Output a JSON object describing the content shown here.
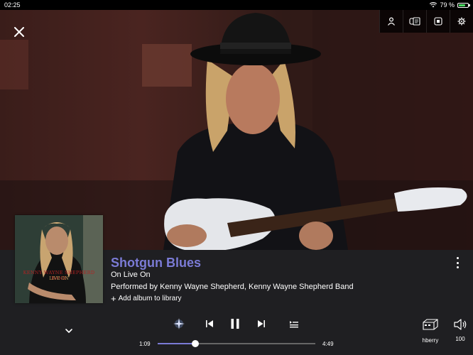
{
  "status_bar": {
    "time": "02:25",
    "battery_text": "79 %",
    "battery_level": 0.79
  },
  "header": {
    "close_icon": "close-icon",
    "icons": [
      "person-icon",
      "lyrics-icon",
      "stop-square-icon",
      "gear-icon"
    ]
  },
  "track": {
    "title": "Shotgun Blues",
    "album_line": "On Live On",
    "performer_line": "Performed by Kenny Wayne Shepherd, Kenny Wayne Shepherd Band",
    "add_album_label": "Add album to library",
    "album_art_text": "KENNY WAYNE SHEPHERD BAND",
    "album_art_subtext": "LIVE ON"
  },
  "player": {
    "elapsed": "1:09",
    "duration": "4:49",
    "progress": 0.24,
    "device_name": "hberry",
    "volume": "100"
  },
  "colors": {
    "accent": "#7b7bd6",
    "panel_bg": "#1f1f22",
    "battery_green": "#4cd964"
  }
}
